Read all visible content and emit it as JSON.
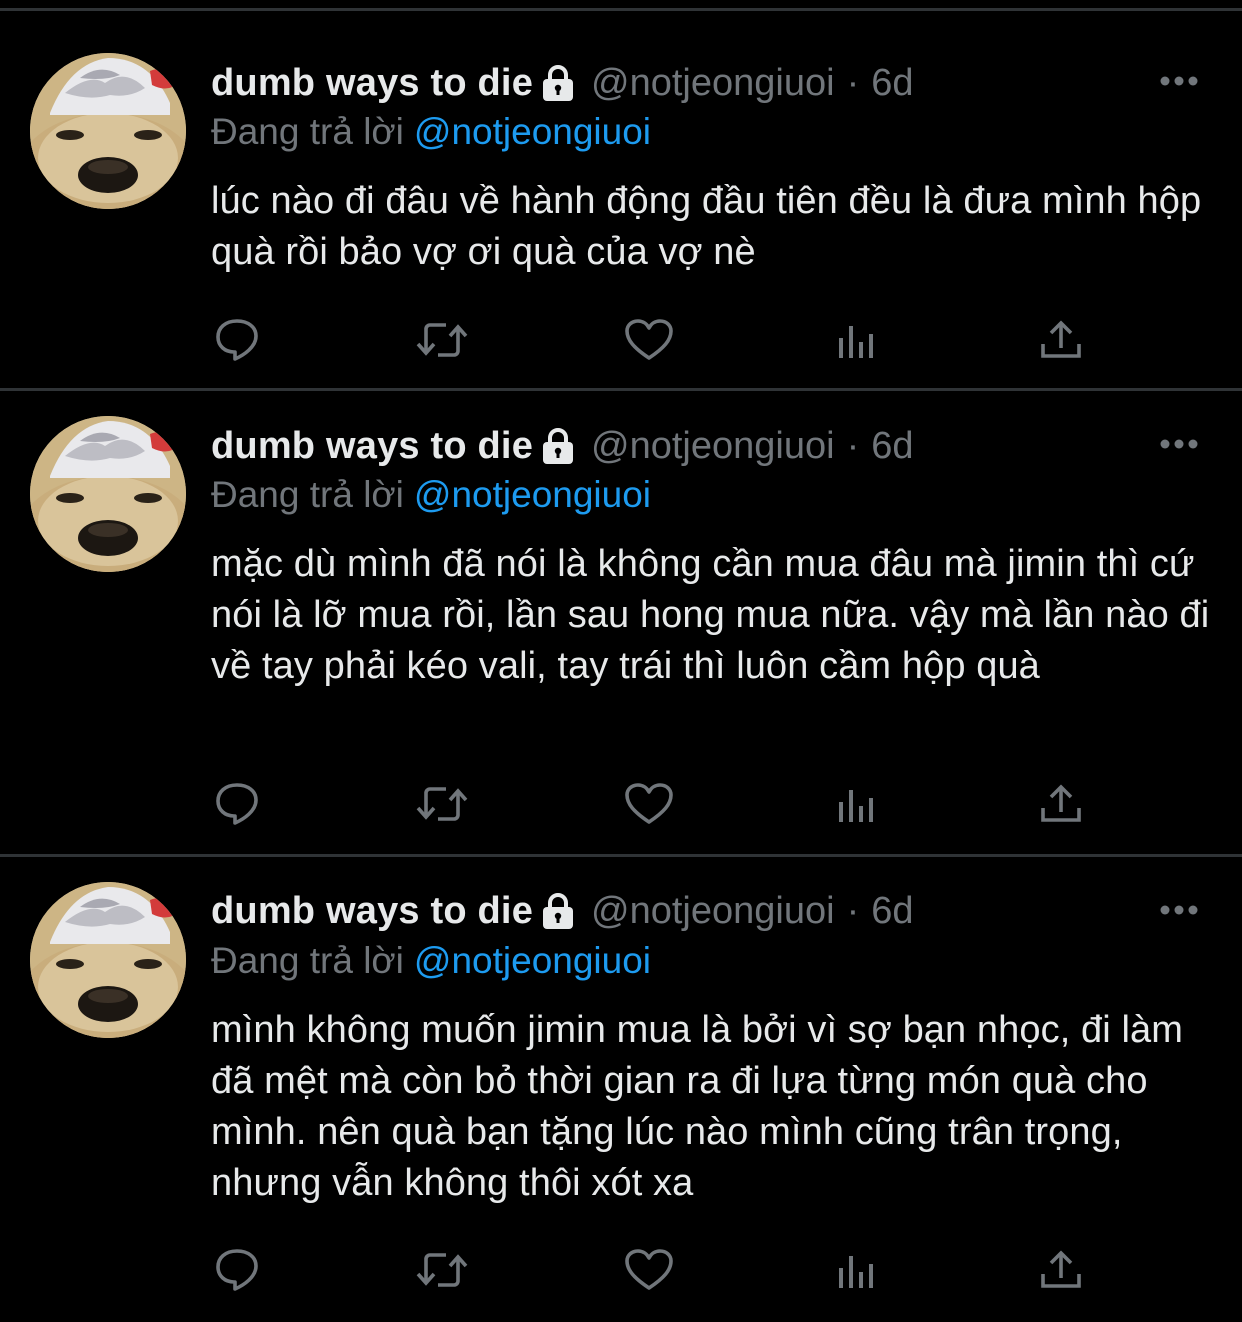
{
  "colors": {
    "background": "#000000",
    "divider": "#2F3336",
    "primary_text": "#E7E9EA",
    "secondary_text": "#71767B",
    "link": "#1D9BF0",
    "action_icon": "#71767B"
  },
  "tweets": [
    {
      "display_name": "dumb ways to die",
      "handle": "@notjeongiuoi",
      "separator": "·",
      "time": "6d",
      "replying_to_label": "Đang trả lời",
      "replying_to_handle": "@notjeongiuoi",
      "text": "lúc nào đi đâu về hành động đầu tiên đều là đưa mình hộp quà rồi bảo vợ ơi quà của vợ nè",
      "icons": {
        "lock": "lock-icon",
        "more": "more-icon",
        "reply": "reply-icon",
        "retweet": "retweet-icon",
        "like": "heart-icon",
        "views": "analytics-icon",
        "share": "share-icon"
      }
    },
    {
      "display_name": "dumb ways to die",
      "handle": "@notjeongiuoi",
      "separator": "·",
      "time": "6d",
      "replying_to_label": "Đang trả lời",
      "replying_to_handle": "@notjeongiuoi",
      "text": "mặc dù mình đã nói là không cần mua đâu mà jimin thì cứ nói là lỡ mua rồi, lần sau hong mua nữa. vậy mà lần nào đi về tay phải kéo vali, tay trái thì luôn cầm hộp quà",
      "icons": {
        "lock": "lock-icon",
        "more": "more-icon",
        "reply": "reply-icon",
        "retweet": "retweet-icon",
        "like": "heart-icon",
        "views": "analytics-icon",
        "share": "share-icon"
      }
    },
    {
      "display_name": "dumb ways to die",
      "handle": "@notjeongiuoi",
      "separator": "·",
      "time": "6d",
      "replying_to_label": "Đang trả lời",
      "replying_to_handle": "@notjeongiuoi",
      "text": "mình không muốn jimin mua là bởi vì sợ bạn nhọc, đi làm đã mệt mà còn bỏ thời gian ra đi lựa từng món quà cho mình. nên quà bạn tặng lúc nào mình cũng trân trọng, nhưng vẫn không thôi xót xa",
      "icons": {
        "lock": "lock-icon",
        "more": "more-icon",
        "reply": "reply-icon",
        "retweet": "retweet-icon",
        "like": "heart-icon",
        "views": "analytics-icon",
        "share": "share-icon"
      }
    }
  ]
}
